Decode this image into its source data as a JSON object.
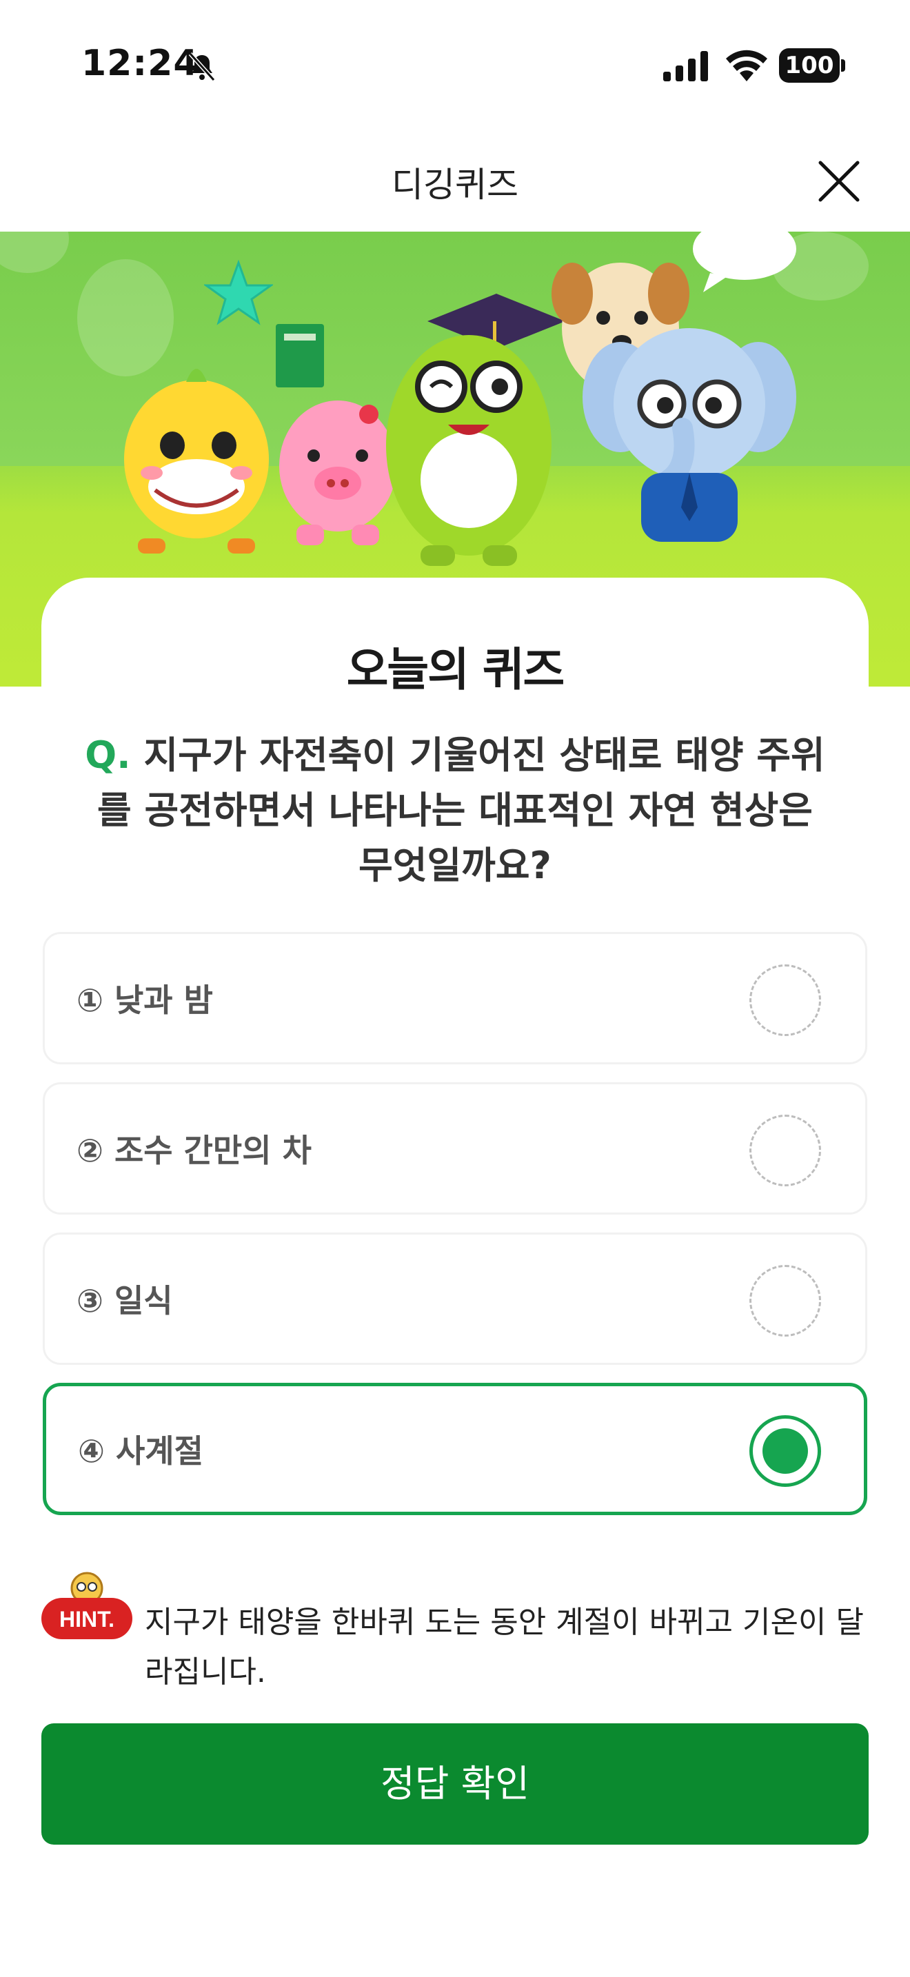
{
  "status_bar": {
    "time": "12:24",
    "battery": "100",
    "icons": [
      "bell-slash-icon",
      "signal-icon",
      "wifi-icon",
      "battery-icon"
    ]
  },
  "header": {
    "title": "디깅퀴즈",
    "close_icon": "close-icon"
  },
  "quiz": {
    "title": "오늘의 퀴즈",
    "question_prefix": "Q.",
    "question_text": " 지구가 자전축이 기울어진 상태로 태양 주위를 공전하면서 나타나는 대표적인 자연 현상은 무엇일까요?",
    "options": [
      {
        "label": "① 낮과 밤",
        "selected": false
      },
      {
        "label": "② 조수 간만의 차",
        "selected": false
      },
      {
        "label": "③ 일식",
        "selected": false
      },
      {
        "label": "④ 사계절",
        "selected": true
      }
    ]
  },
  "hint": {
    "badge": "HINT.",
    "text": "지구가 태양을 한바퀴 도는 동안 계절이 바뀌고 기온이 달라집니다."
  },
  "submit": {
    "label": "정답 확인"
  },
  "colors": {
    "accent": "#16a550",
    "button": "#0b8a2f",
    "banner_green": "#86d44c",
    "hint_red": "#d92222"
  }
}
